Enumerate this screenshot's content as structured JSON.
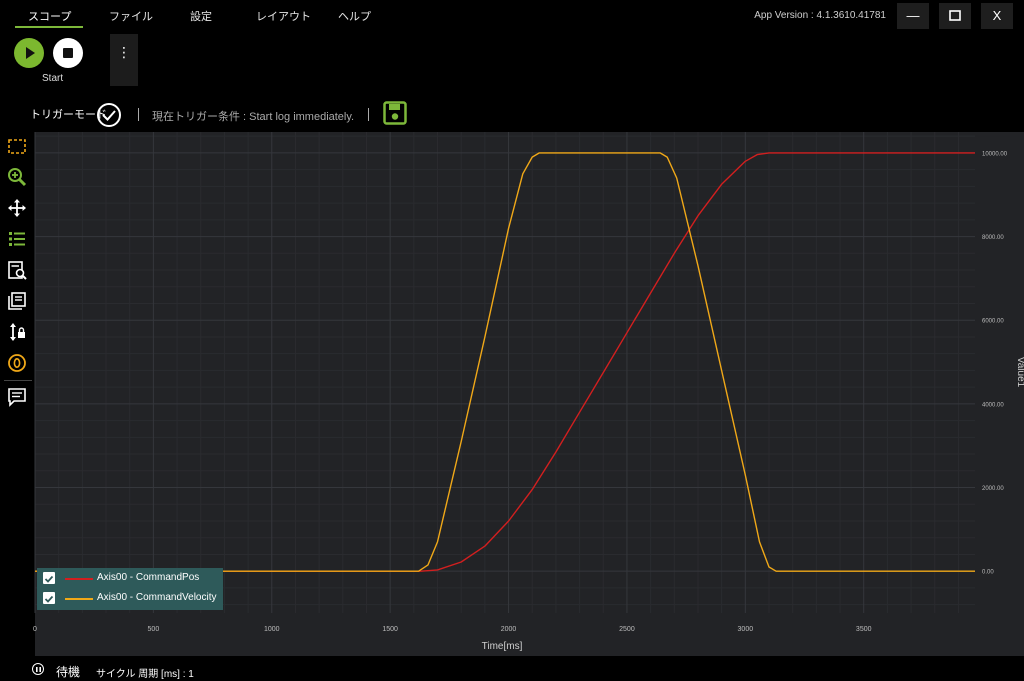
{
  "menu": {
    "tabs": [
      "スコープ",
      "ファイル",
      "設定",
      "レイアウト",
      "ヘルプ"
    ],
    "app_version": "App Version : 4.1.3610.41781",
    "minimize": "—",
    "close": "X"
  },
  "toolbar": {
    "start_label": "Start",
    "more": "⋮"
  },
  "trigger": {
    "mode_label": "トリガーモード",
    "condition": "現在トリガー条件 : Start log immediately."
  },
  "colors": {
    "accent": "#7db83a",
    "command_pos": "#d21f1f",
    "command_velocity": "#f0a818",
    "plot_bg": "#222326",
    "legend_bg": "#2e5a5a"
  },
  "sidebar_icons": [
    "select-area-icon",
    "zoom-in-icon",
    "pan-icon",
    "list-icon",
    "search-report-icon",
    "layers-icon",
    "axis-lock-icon",
    "zero-icon",
    "comment-icon"
  ],
  "chart_data": {
    "type": "line",
    "xlabel": "Time[ms]",
    "ylabel": "Value1",
    "xlim": [
      0,
      3970
    ],
    "ylim": [
      -1000,
      10500
    ],
    "x_ticks": [
      "0",
      "500",
      "1000",
      "1500",
      "2000",
      "2500",
      "3000",
      "3500"
    ],
    "y_ticks": [
      "0.00",
      "2000.00",
      "4000.00",
      "6000.00",
      "8000.00",
      "10000.00"
    ],
    "series": [
      {
        "name": "Axis00 - CommandPos",
        "color": "#d21f1f",
        "checked": true,
        "x": [
          0,
          1630,
          1700,
          1800,
          1900,
          2000,
          2100,
          2200,
          2300,
          2400,
          2500,
          2600,
          2700,
          2800,
          2900,
          3000,
          3050,
          3100,
          3150,
          3970
        ],
        "y": [
          0,
          0,
          30,
          220,
          600,
          1200,
          1950,
          2850,
          3800,
          4750,
          5700,
          6650,
          7600,
          8500,
          9250,
          9800,
          9960,
          10000,
          10000,
          10000
        ]
      },
      {
        "name": "Axis00 - CommandVelocity",
        "color": "#f0a818",
        "checked": true,
        "x": [
          0,
          1620,
          1660,
          1700,
          1800,
          1900,
          2000,
          2060,
          2100,
          2130,
          2640,
          2670,
          2710,
          2800,
          2900,
          3000,
          3060,
          3100,
          3130,
          3970
        ],
        "y": [
          0,
          0,
          150,
          700,
          3100,
          5600,
          8200,
          9500,
          9900,
          10000,
          10000,
          9900,
          9400,
          7300,
          4800,
          2300,
          700,
          100,
          0,
          0
        ]
      }
    ]
  },
  "status": {
    "state": "待機",
    "cycle": "サイクル 周期 [ms] : 1"
  }
}
